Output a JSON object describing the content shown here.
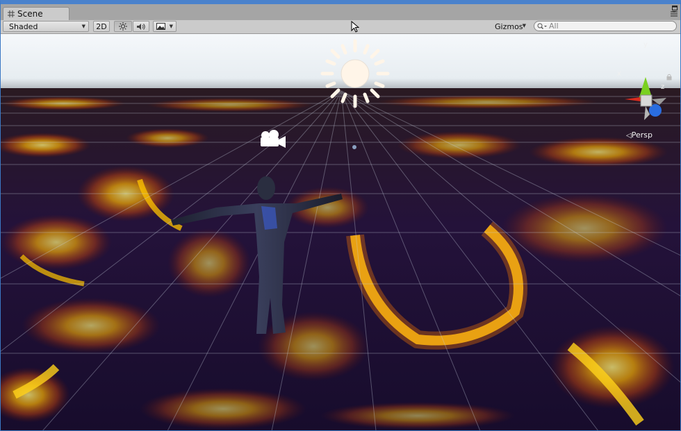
{
  "window": {
    "tab_title": "Scene"
  },
  "toolbar": {
    "shading_mode": "Shaded",
    "mode_2d_label": "2D",
    "gizmos_label": "Gizmos",
    "search_placeholder": "All"
  },
  "scene": {
    "projection_label": "Persp",
    "axis_labels": {
      "x": "x",
      "y": "y",
      "z": "z"
    },
    "icons": [
      "sun-icon",
      "camera-icon",
      "scene-gizmo",
      "lock-icon"
    ]
  },
  "colors": {
    "window_border": "#4a82cc",
    "toolbar_bg": "#cbcbcb",
    "lava_glow": "#ffb300",
    "lava_dark": "#1a0f2a",
    "sky": "#eaf0f5",
    "gizmo_x": "#d92b1e",
    "gizmo_y": "#7ad020",
    "gizmo_z": "#2a6de0"
  }
}
